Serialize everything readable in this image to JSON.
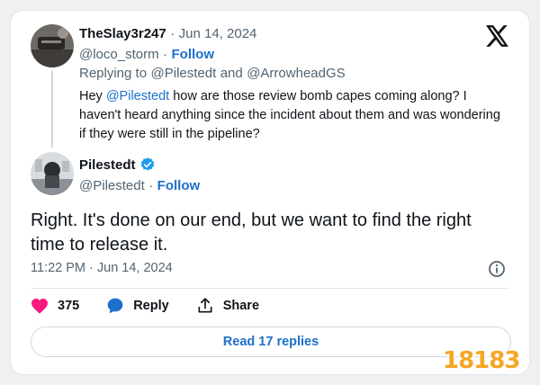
{
  "reply_tweet": {
    "author_name": "TheSlay3r247",
    "separator": "·",
    "date": "Jun 14, 2024",
    "handle": "@loco_storm",
    "dot": "·",
    "follow_label": "Follow",
    "replying_prefix": "Replying to",
    "replying_user1": "@Pilestedt",
    "replying_and": "and",
    "replying_user2": "@ArrowheadGS",
    "text_hey": "Hey",
    "text_mention": "@Pilestedt",
    "text_rest": "how are those review bomb capes coming along? I haven't heard anything since the incident about them and was wondering if they were still in the pipeline?"
  },
  "main_tweet": {
    "author_name": "Pilestedt",
    "handle": "@Pilestedt",
    "dot": "·",
    "follow_label": "Follow",
    "text": "Right. It's done on our end, but we want to find the right time to release it.",
    "timestamp": "11:22 PM · Jun 14, 2024"
  },
  "actions": {
    "like_count": "375",
    "reply_label": "Reply",
    "share_label": "Share"
  },
  "read_replies_label": "Read 17 replies",
  "watermark": "18183",
  "colors": {
    "accent": "#1d6fcc",
    "like": "#f91880",
    "verified": "#1d9bf0",
    "watermark": "#f5a623"
  },
  "icons": [
    "x-logo-icon",
    "verified-badge-icon",
    "info-icon",
    "heart-icon",
    "reply-bubble-icon",
    "share-icon"
  ]
}
